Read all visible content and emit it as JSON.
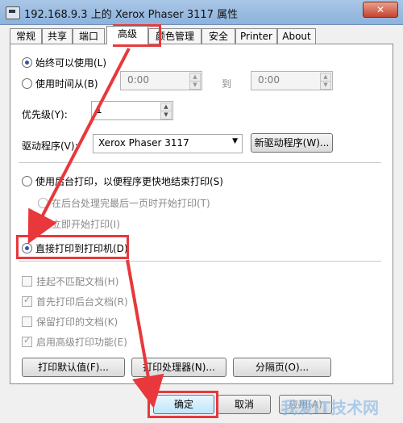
{
  "window": {
    "title": "192.168.9.3 上的 Xerox Phaser 3117 属性",
    "close_glyph": "✕"
  },
  "tabs": [
    {
      "label": "常规"
    },
    {
      "label": "共享"
    },
    {
      "label": "端口"
    },
    {
      "label": "高级",
      "active": true
    },
    {
      "label": "颜色管理"
    },
    {
      "label": "安全"
    },
    {
      "label": "Printer"
    },
    {
      "label": "About"
    }
  ],
  "availability": {
    "always_label": "始终可以使用(L)",
    "from_label": "使用时间从(B)",
    "from_time": "0:00",
    "to_label": "到",
    "to_time": "0:00"
  },
  "priority": {
    "label": "优先级(Y):",
    "value": "1"
  },
  "driver": {
    "label": "驱动程序(V):",
    "value": "Xerox Phaser 3117",
    "new_driver_button": "新驱动程序(W)..."
  },
  "spool": {
    "spool_label": "使用后台打印，以便程序更快地结束打印(S)",
    "after_last_page_label": "在后台处理完最后一页时开始打印(T)",
    "immediately_label": "立即开始打印(I)",
    "direct_label": "直接打印到打印机(D)"
  },
  "options": [
    {
      "label": "挂起不匹配文档(H)",
      "checked": false
    },
    {
      "label": "首先打印后台文档(R)",
      "checked": true
    },
    {
      "label": "保留打印的文档(K)",
      "checked": false
    },
    {
      "label": "启用高级打印功能(E)",
      "checked": true
    }
  ],
  "buttons": {
    "defaults": "打印默认值(F)...",
    "processor": "打印处理器(N)...",
    "separator": "分隔页(O)...",
    "ok": "确定",
    "cancel": "取消",
    "apply": "应用(A)"
  },
  "watermark": "我爱IT技术网",
  "colors": {
    "highlight": "#e8383c",
    "title_bar": "#a9c6e6",
    "radio_selected": "#2b56a8"
  }
}
